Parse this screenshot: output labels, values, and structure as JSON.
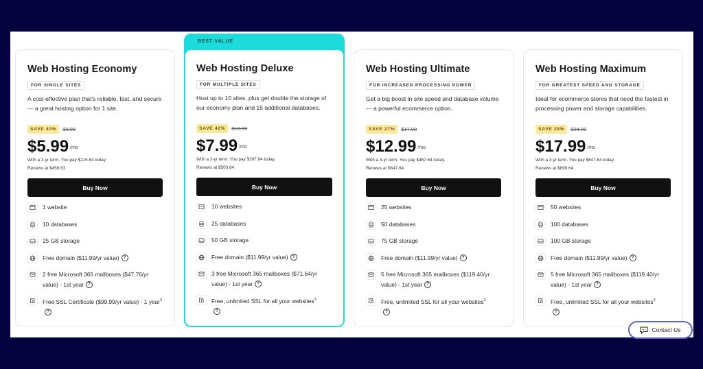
{
  "badge": {
    "best_value": "BEST VALUE"
  },
  "contact": {
    "label": "Contact Us",
    "icon": "chat-icon"
  },
  "colors": {
    "background": "#04023f",
    "featured": "#1bdbdb",
    "save_badge": "#fbe89a",
    "button": "#111111",
    "contact_border": "#5a62c8"
  },
  "plans": [
    {
      "title": "Web Hosting Economy",
      "tag": "FOR SINGLE SITES",
      "description": "A cost-effective plan that's reliable, fast, and secure — a great hosting option for 1 site.",
      "save": "SAVE 40%",
      "old_price": "$9.99",
      "price": "$5.99",
      "per": "/mo",
      "term": "With a 3-yr term. You pay $215.64 today",
      "renews": "Renews at $459.63",
      "cta": "Buy Now",
      "features": {
        "websites": "1 website",
        "databases": "10 databases",
        "storage": "25 GB storage",
        "domain": "Free domain ($11.99/yr value)",
        "mailboxes": "2 free Microsoft 365 mailboxes ($47.76/yr value) - 1st year",
        "ssl": "Free SSL Certificate ($99.99/yr value) - 1 year",
        "ssl_sup": "3"
      }
    },
    {
      "title": "Web Hosting Deluxe",
      "tag": "FOR MULTIPLE SITES",
      "description": "Host up to 10 sites, plus get double the storage of our economy plan and 15 additional databases.",
      "save": "SAVE 42%",
      "old_price": "$13.99",
      "price": "$7.99",
      "per": "/mo",
      "term": "With a 3-yr term. You pay $287.64 today.",
      "renews": "Renews at $503.64.",
      "cta": "Buy Now",
      "features": {
        "websites": "10 websites",
        "databases": "25 databases",
        "storage": "50 GB storage",
        "domain": "Free domain ($11.99/yr value)",
        "mailboxes": "3 free Microsoft 365 mailboxes ($71.64/yr value) - 1st year",
        "ssl": "Free, unlimited SSL for all your websites",
        "ssl_sup": "3"
      }
    },
    {
      "title": "Web Hosting Ultimate",
      "tag": "FOR INCREASED PROCESSING POWER",
      "description": "Get a big boost in site speed and database volume — a powerful ecommerce option.",
      "save": "SAVE 27%",
      "old_price": "$17.99",
      "price": "$12.99",
      "per": "/mo",
      "term": "With a 3-yr term. You pay $467.64 today.",
      "renews": "Renews at $647.64.",
      "cta": "Buy Now",
      "features": {
        "websites": "25 websites",
        "databases": "50 databases",
        "storage": "75 GB storage",
        "domain": "Free domain ($11.99/yr value)",
        "mailboxes": "5 free Microsoft 365 mailboxes ($119.40/yr value) - 1st year",
        "ssl": "Free, unlimited SSL for all your websites",
        "ssl_sup": "3"
      }
    },
    {
      "title": "Web Hosting Maximum",
      "tag": "FOR GREATEST SPEED AND STORAGE",
      "description": "Ideal for ecommerce stores that need the fastest in processing power and storage capabilities.",
      "save": "SAVE 28%",
      "old_price": "$24.99",
      "price": "$17.99",
      "per": "/mo",
      "term": "With a 3-yr term. You pay $647.64 today.",
      "renews": "Renews at $899.64.",
      "cta": "Buy Now",
      "features": {
        "websites": "50 websites",
        "databases": "100 databases",
        "storage": "100 GB storage",
        "domain": "Free domain ($11.99/yr value)",
        "mailboxes": "5 free Microsoft 365 mailboxes ($119.40/yr value) - 1st year",
        "ssl": "Free, unlimited SSL for all your websites",
        "ssl_sup": "3"
      }
    }
  ],
  "help_glyph": "?"
}
